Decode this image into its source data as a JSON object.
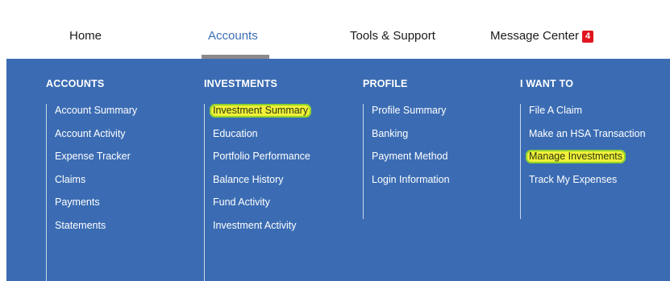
{
  "nav": {
    "tabs": [
      {
        "label": "Home"
      },
      {
        "label": "Accounts",
        "active": true
      },
      {
        "label": "Tools & Support"
      },
      {
        "label": "Message Center",
        "badge": "4"
      }
    ]
  },
  "menu": {
    "accounts": {
      "title": "ACCOUNTS",
      "items": [
        "Account Summary",
        "Account Activity",
        "Expense Tracker",
        "Claims",
        "Payments",
        "Statements"
      ]
    },
    "investments": {
      "title": "INVESTMENTS",
      "items": [
        "Investment Summary",
        "Education",
        "Portfolio Performance",
        "Balance History",
        "Fund Activity",
        "Investment Activity"
      ]
    },
    "profile": {
      "title": "PROFILE",
      "items": [
        "Profile Summary",
        "Banking",
        "Payment Method",
        "Login Information"
      ]
    },
    "i_want_to": {
      "title": "I WANT TO",
      "items": [
        "File A Claim",
        "Make an HSA Transaction",
        "Manage Investments",
        "Track My Expenses"
      ]
    }
  },
  "colors": {
    "menu_background": "#3b6cb3",
    "active_tab_text": "#3a6db5",
    "badge_red": "#e0161f",
    "highlight_yellow": "#f2f03a"
  }
}
